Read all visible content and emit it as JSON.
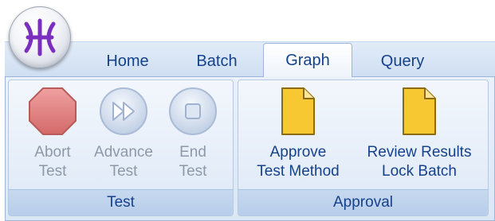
{
  "tabs": [
    {
      "label": "Home"
    },
    {
      "label": "Batch"
    },
    {
      "label": "Graph"
    },
    {
      "label": "Query"
    }
  ],
  "groups": {
    "test": {
      "label": "Test",
      "buttons": [
        {
          "line1": "Abort",
          "line2": "Test",
          "icon": "stop-octagon-icon"
        },
        {
          "line1": "Advance",
          "line2": "Test",
          "icon": "fast-forward-icon"
        },
        {
          "line1": "End",
          "line2": "Test",
          "icon": "stop-square-icon"
        }
      ]
    },
    "approval": {
      "label": "Approval",
      "buttons": [
        {
          "line1": "Approve",
          "line2": "Test Method",
          "icon": "document-icon"
        },
        {
          "line1": "Review Results",
          "line2": "Lock Batch",
          "icon": "document-icon"
        }
      ]
    }
  },
  "colors": {
    "accent_text": "#15428b",
    "disabled_text": "#8d99a8",
    "document_fill": "#f7c832",
    "orb_glyph": "#7b2fbf"
  }
}
